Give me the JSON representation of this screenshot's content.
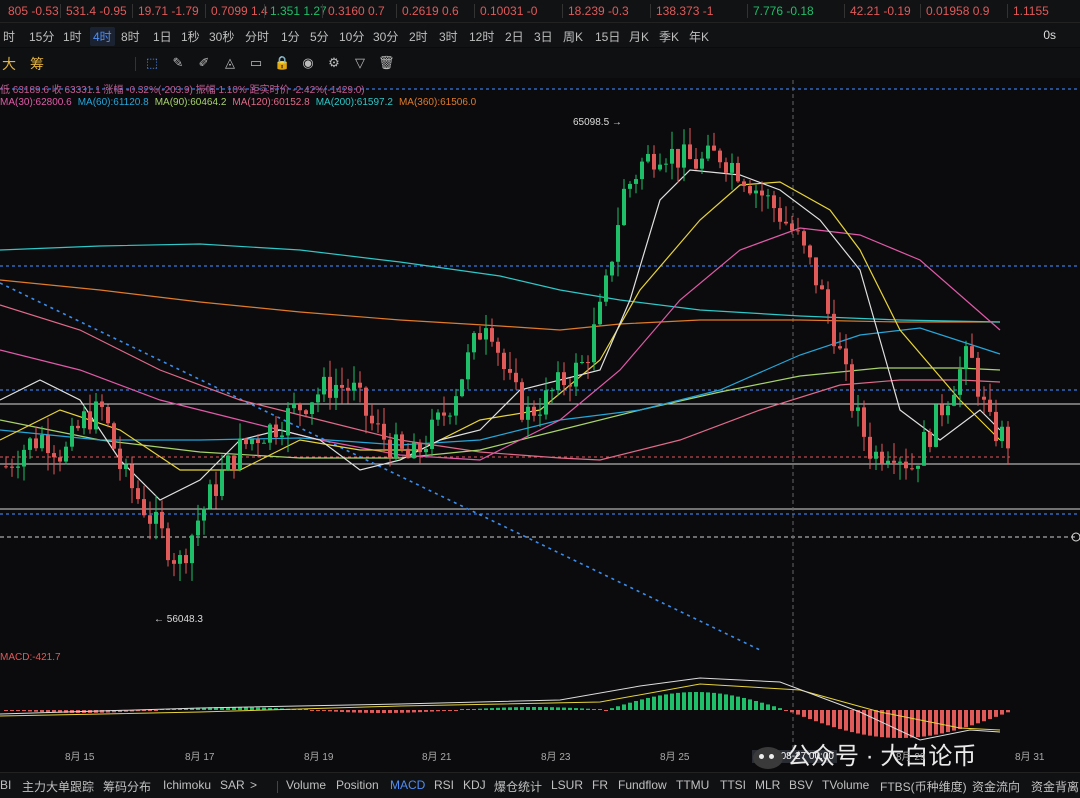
{
  "ticker": [
    {
      "text": "805 -0.53",
      "color": "#e05a5a"
    },
    {
      "text": "531.4 -0.95",
      "color": "#e05a5a"
    },
    {
      "text": "19.71 -1.79",
      "color": "#e05a5a"
    },
    {
      "text": "0.7099 1.4",
      "color": "#e05a5a"
    },
    {
      "text": "1.351 1.27",
      "color": "#1fbf6a"
    },
    {
      "text": "0.3160 0.7",
      "color": "#e05a5a"
    },
    {
      "text": "0.2619 0.6",
      "color": "#e05a5a"
    },
    {
      "text": "0.10031 -0",
      "color": "#e05a5a"
    },
    {
      "text": "18.239 -0.3",
      "color": "#e05a5a"
    },
    {
      "text": "138.373 -1",
      "color": "#e05a5a"
    },
    {
      "text": "7.776 -0.18",
      "color": "#1fbf6a"
    },
    {
      "text": "42.21 -0.19",
      "color": "#e05a5a"
    },
    {
      "text": "0.01958 0.9",
      "color": "#e05a5a"
    },
    {
      "text": "1.1155",
      "color": "#e05a5a"
    }
  ],
  "intervals": [
    "时",
    "15分",
    "1时",
    "4时",
    "8时",
    "1日",
    "1秒",
    "30秒",
    "分时",
    "1分",
    "5分",
    "10分",
    "30分",
    "2时",
    "3时",
    "12时",
    "2日",
    "3日",
    "周K",
    "15日",
    "月K",
    "季K",
    "年K"
  ],
  "active_interval": "4时",
  "interval_right": "0s",
  "toolbar": {
    "label_a": "大",
    "label_b": "筹"
  },
  "icons": [
    "cursor-icon",
    "pencil-icon",
    "brush-icon",
    "compass-icon",
    "ruler-icon",
    "lock-icon",
    "eye-icon",
    "settings-icon",
    "filter-icon",
    "trash-icon"
  ],
  "info_line1": "低 63189.6  收 63331.1  涨幅 -0.32%(-203.9)  振幅 1.10%  距实时价 -2.42%(-1429.0)",
  "ma_legend": [
    {
      "label": "MA(30):62800.6",
      "color": "#e05aa8"
    },
    {
      "label": "MA(60):61120.8",
      "color": "#25a6d9"
    },
    {
      "label": "MA(90):60464.2",
      "color": "#a8d36b"
    },
    {
      "label": "MA(120):60152.8",
      "color": "#e06a8a"
    },
    {
      "label": "MA(200):61597.2",
      "color": "#2fc7c7"
    },
    {
      "label": "MA(360):61506.0",
      "color": "#e07b2a"
    }
  ],
  "high_label": "65098.5",
  "low_label": "56048.3",
  "macd_label": "MACD:-421.7",
  "x_labels": [
    "8月 15",
    "8月 17",
    "8月 19",
    "8月 21",
    "8月 23",
    "8月 25",
    "8月 29",
    "8月 31"
  ],
  "crosshair_date": "2024-08-27 00:00",
  "watermark": "公众号 · 大白论币",
  "indicators": [
    "BI",
    "主力大单跟踪",
    "筹码分布",
    "Ichimoku",
    "SAR",
    ">",
    "Volume",
    "Position",
    "MACD",
    "RSI",
    "KDJ",
    "爆仓统计",
    "LSUR",
    "FR",
    "Fundflow",
    "TTMU",
    "TTSI",
    "MLR",
    "BSV",
    "TVolume",
    "FTBS(币种维度)",
    "资金流向",
    "资金背离"
  ],
  "active_indicator": "MACD",
  "colors": {
    "up": "#1fbf6a",
    "down": "#e05a5a",
    "accent": "#4f8df5"
  },
  "chart_data": {
    "type": "candlestick",
    "price_high": 65098.5,
    "price_low": 56048.3,
    "trend": [
      58500,
      58900,
      59100,
      58700,
      59400,
      59600,
      58400,
      57800,
      57200,
      56600,
      57500,
      58200,
      58800,
      59100,
      59300,
      59600,
      59900,
      60100,
      60000,
      59300,
      58900,
      58600,
      59100,
      59700,
      60600,
      61500,
      60200,
      59500,
      59800,
      60200,
      60500,
      61700,
      63800,
      64400,
      64700,
      64500,
      64400,
      64600,
      64300,
      63900,
      63500,
      63000,
      62200,
      61100,
      59600,
      58700,
      58900,
      58500,
      59200,
      60000,
      60700,
      59300,
      59000
    ]
  }
}
